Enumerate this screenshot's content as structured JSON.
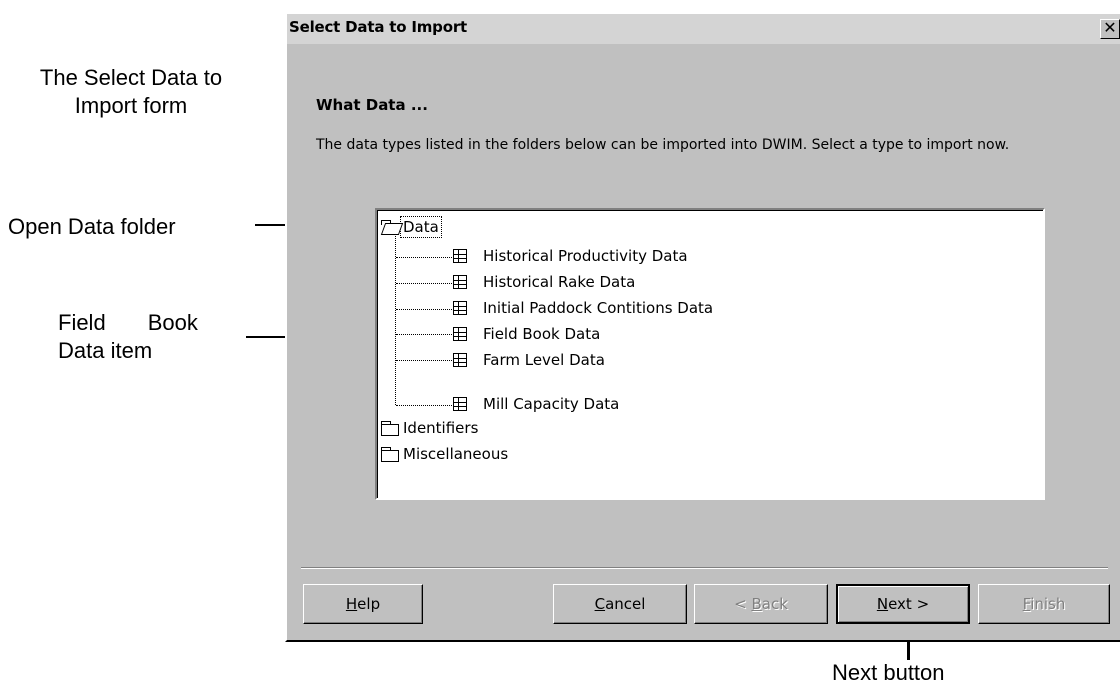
{
  "annotations": {
    "form_label_line1": "The Select Data to",
    "form_label_line2": "Import form",
    "open_folder_label": "Open Data folder",
    "field_book_line1a": "Field",
    "field_book_line1b": "Book",
    "field_book_line2": "Data item",
    "next_button_label": "Next button"
  },
  "dialog": {
    "title": "Select Data to Import",
    "close_glyph": "✕",
    "heading": "What Data ...",
    "description": "The data types listed in the folders below can be imported into DWIM.  Select a type to import now."
  },
  "tree": {
    "root": {
      "label": "Data",
      "state": "open"
    },
    "children": [
      {
        "label": "Historical Productivity Data",
        "icon": "table-icon"
      },
      {
        "label": "Historical Rake Data",
        "icon": "table-icon"
      },
      {
        "label": "Initial Paddock Contitions Data",
        "icon": "table-icon"
      },
      {
        "label": "Field Book Data",
        "icon": "table-icon"
      },
      {
        "label": "Farm Level Data",
        "icon": "table-icon"
      },
      {
        "label": "Mill Capacity Data",
        "icon": "table-icon"
      }
    ],
    "folders": [
      {
        "label": "Identifiers",
        "state": "closed"
      },
      {
        "label": "Miscellaneous",
        "state": "closed"
      }
    ]
  },
  "buttons": {
    "help": {
      "mnemonic": "H",
      "rest": "elp"
    },
    "cancel": {
      "mnemonic": "C",
      "rest": "ancel"
    },
    "back": {
      "prefix": "< ",
      "mnemonic": "B",
      "rest": "ack"
    },
    "next": {
      "mnemonic": "N",
      "rest": "ext >"
    },
    "finish": {
      "mnemonic": "F",
      "rest": "inish"
    }
  }
}
